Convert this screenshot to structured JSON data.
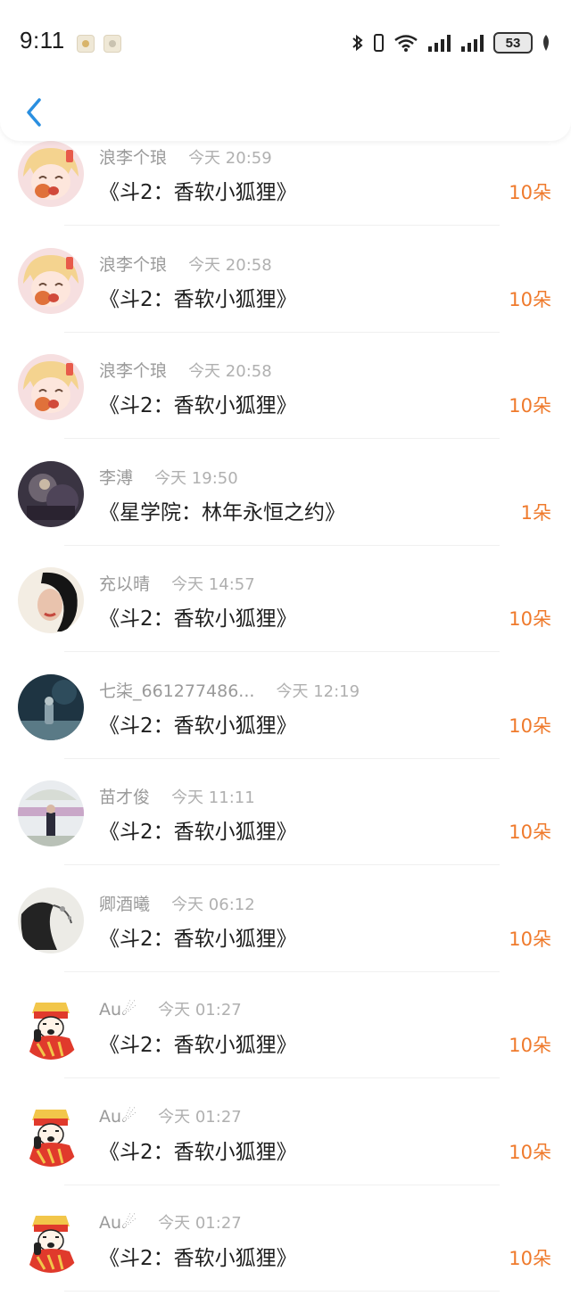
{
  "status_bar": {
    "time": "9:11",
    "battery": "53",
    "icons": [
      "bluetooth-icon",
      "vibrate-icon",
      "wifi-icon",
      "signal-icon",
      "signal-icon",
      "battery-icon",
      "leaf-icon"
    ]
  },
  "nav": {
    "back_icon": "chevron-left-icon"
  },
  "colors": {
    "accent": "#ef7a2c",
    "back": "#2a8fe0",
    "name": "#9a9a9a",
    "title": "#1f1f1f"
  },
  "gifts": [
    {
      "user": "浪李个琅",
      "time": "今天 20:59",
      "title": "《斗2：香软小狐狸》",
      "amount": "10朵",
      "avatar": "anime-girl"
    },
    {
      "user": "浪李个琅",
      "time": "今天 20:58",
      "title": "《斗2：香软小狐狸》",
      "amount": "10朵",
      "avatar": "anime-girl"
    },
    {
      "user": "浪李个琅",
      "time": "今天 20:58",
      "title": "《斗2：香软小狐狸》",
      "amount": "10朵",
      "avatar": "anime-girl"
    },
    {
      "user": "李溥",
      "time": "今天 19:50",
      "title": "《星学院：林年永恒之约》",
      "amount": "1朵",
      "avatar": "dark-art"
    },
    {
      "user": "充以晴",
      "time": "今天 14:57",
      "title": "《斗2：香软小狐狸》",
      "amount": "10朵",
      "avatar": "woman-portrait"
    },
    {
      "user": "七柒_661277486...",
      "time": "今天 12:19",
      "title": "《斗2：香软小狐狸》",
      "amount": "10朵",
      "avatar": "night-scene"
    },
    {
      "user": "苗才俊",
      "time": "今天 11:11",
      "title": "《斗2：香软小狐狸》",
      "amount": "10朵",
      "avatar": "umbrella-scene"
    },
    {
      "user": "卿酒曦",
      "time": "今天 06:12",
      "title": "《斗2：香软小狐狸》",
      "amount": "10朵",
      "avatar": "gray-sketch"
    },
    {
      "user": "Au☄",
      "time": "今天 01:27",
      "title": "《斗2：香软小狐狸》",
      "amount": "10朵",
      "avatar": "singer-cartoon"
    },
    {
      "user": "Au☄",
      "time": "今天 01:27",
      "title": "《斗2：香软小狐狸》",
      "amount": "10朵",
      "avatar": "singer-cartoon"
    },
    {
      "user": "Au☄",
      "time": "今天 01:27",
      "title": "《斗2：香软小狐狸》",
      "amount": "10朵",
      "avatar": "singer-cartoon"
    }
  ]
}
